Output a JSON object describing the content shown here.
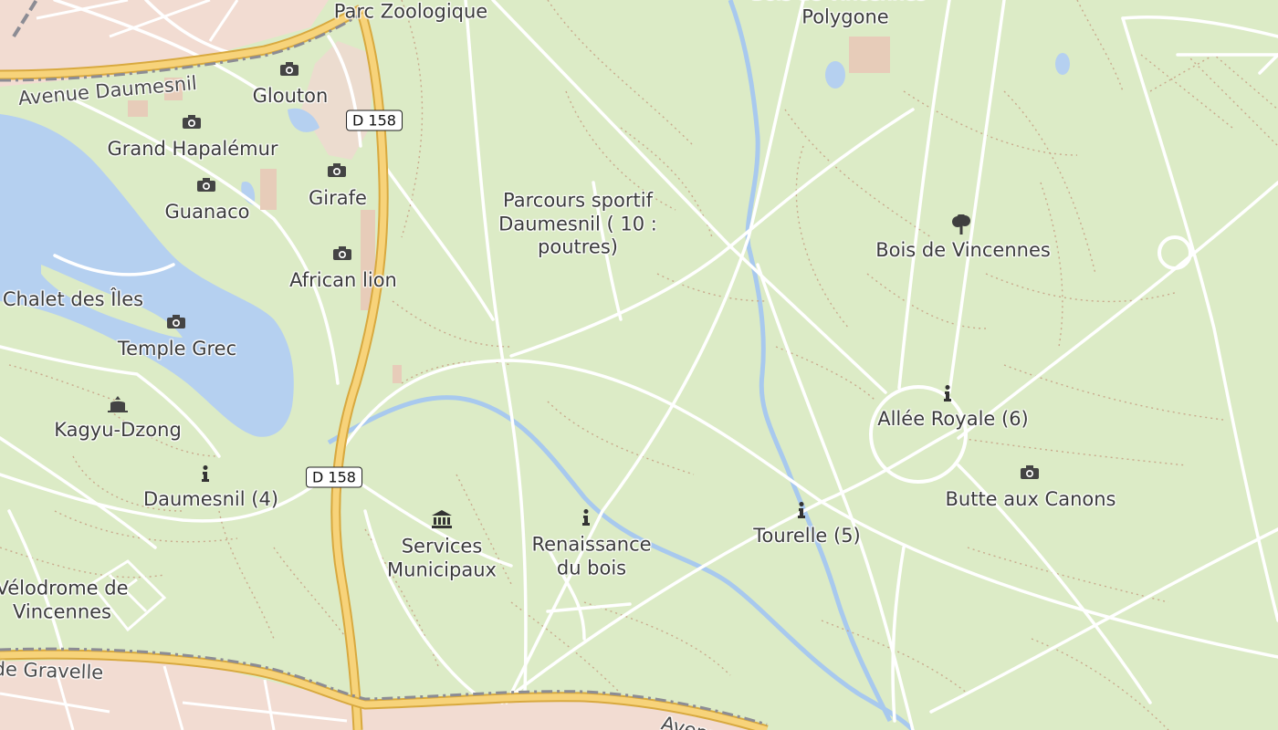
{
  "colors": {
    "park": "#dcebc6",
    "urban": "#f2dcd2",
    "water": "#b5d0f0",
    "major_road": "#f7d37a",
    "path": "#ffffff",
    "footway": "#c9a98c",
    "railway": "#8c8c94"
  },
  "places": {
    "zoo": "Bois de Vincennes - Parc Zoologique",
    "polygone": "Bois de Vincennes - Polygone",
    "glouton": "Glouton",
    "hapalemur": "Grand Hapalémur",
    "girafe": "Girafe",
    "guanaco": "Guanaco",
    "african_lion": "African lion",
    "chalet": "Chalet des Îles",
    "temple": "Temple Grec",
    "kagyu": "Kagyu-Dzong",
    "daumesnil4": "Daumesnil (4)",
    "velodrome": "Vélodrome de Vincennes",
    "parcours": "Parcours sportif Daumesnil ( 10 : poutres)",
    "bois": "Bois de Vincennes",
    "allee": "Allée Royale (6)",
    "butte": "Butte aux Canons",
    "services": "Services Municipaux",
    "renaissance": "Renaissance du bois",
    "tourelle": "Tourelle (5)"
  },
  "streets": {
    "daumesnil": "Avenue Daumesnil",
    "gravelle": "Avenue de Gravelle",
    "avenue": "Avenue"
  },
  "shields": {
    "north": "D 158",
    "south": "D 158"
  },
  "icons": {
    "viewpoint": "camera-icon",
    "information": "info-icon",
    "temple": "temple-icon",
    "townhall": "townhall-icon",
    "park": "tree-icon"
  }
}
